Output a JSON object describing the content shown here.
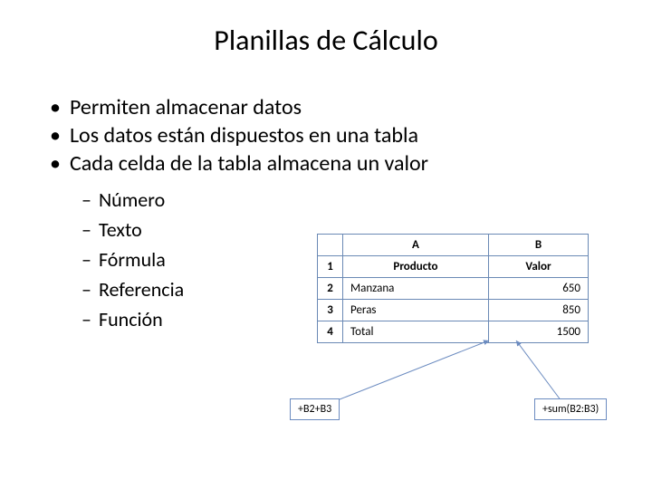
{
  "title": "Planillas de Cálculo",
  "bullets": [
    "Permiten almacenar datos",
    "Los datos están dispuestos en una tabla",
    "Cada celda de la tabla almacena un valor"
  ],
  "subbullets": [
    "Número",
    "Texto",
    "Fórmula",
    "Referencia",
    "Función"
  ],
  "table": {
    "colA": "A",
    "colB": "B",
    "rows": [
      {
        "n": "1",
        "a": "Producto",
        "b": "Valor",
        "a_class": "center",
        "b_class": "center"
      },
      {
        "n": "2",
        "a": "Manzana",
        "b": "650",
        "a_class": "left",
        "b_class": "right"
      },
      {
        "n": "3",
        "a": "Peras",
        "b": "850",
        "a_class": "left",
        "b_class": "right"
      },
      {
        "n": "4",
        "a": "Total",
        "b": "1500",
        "a_class": "left",
        "b_class": "right"
      }
    ]
  },
  "callout_left": "+B2+B3",
  "callout_right": "+sum(B2:B3)"
}
